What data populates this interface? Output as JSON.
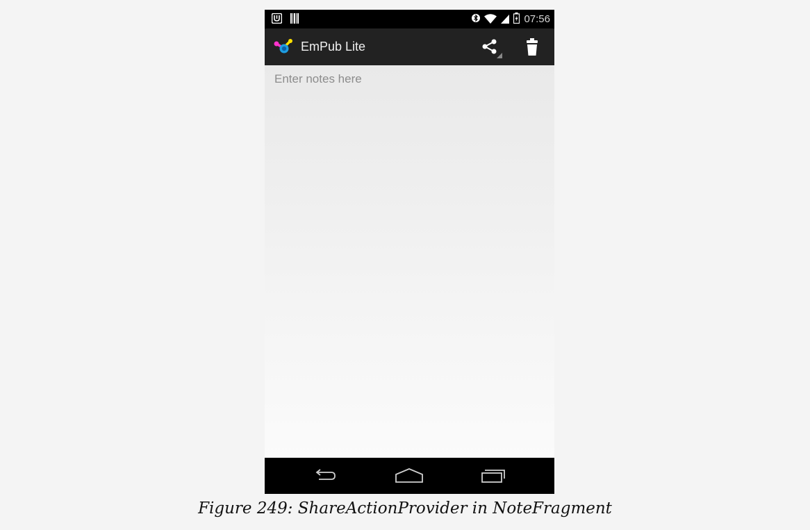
{
  "status_bar": {
    "time": "07:56",
    "left_icons": [
      "notification-app-icon",
      "barcode-icon"
    ],
    "right_icons": [
      "bluetooth-icon",
      "wifi-icon",
      "signal-icon",
      "battery-charging-icon"
    ]
  },
  "action_bar": {
    "title": "EmPub Lite",
    "app_icon": "empub-logo-icon",
    "actions": [
      "share-icon",
      "trash-icon"
    ]
  },
  "note_editor": {
    "value": "",
    "placeholder": "Enter notes here"
  },
  "navigation_bar": {
    "buttons": [
      "back-icon",
      "home-icon",
      "recents-icon"
    ]
  },
  "caption": "Figure 249: ShareActionProvider in NoteFragment",
  "colors": {
    "action_bar": "#222222",
    "status_bar": "#000000",
    "accent_underline": "#33b5e5",
    "content_background": "#ececec"
  }
}
